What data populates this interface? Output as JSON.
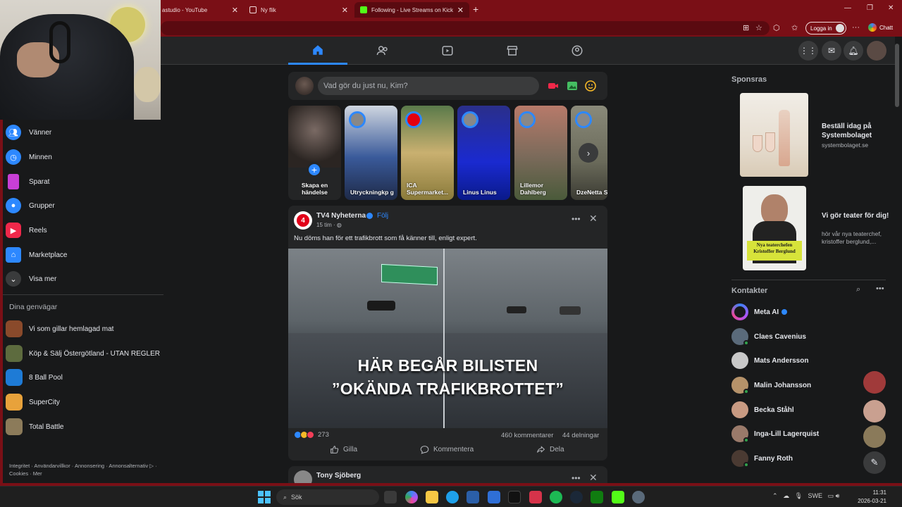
{
  "browser": {
    "tabs": [
      {
        "label": "astudio - YouTube",
        "color": "#ff0000"
      },
      {
        "label": "Ny flik",
        "color": "#8a8a8a"
      },
      {
        "label": "Following - Live Streams on Kick",
        "color": "#53fc18"
      }
    ],
    "login_label": "Logga in",
    "chat_label": "Chatt"
  },
  "fbnav": {
    "tabs": [
      "home-icon",
      "friends-icon",
      "video-icon",
      "marketplace-icon",
      "gaming-icon"
    ],
    "right": [
      "menu-grid-icon",
      "messenger-icon",
      "notifications-icon",
      "profile-avatar"
    ]
  },
  "sidebar": {
    "items": [
      {
        "label": "Vänner",
        "color": "#2d88ff"
      },
      {
        "label": "Minnen",
        "color": "#2d88ff"
      },
      {
        "label": "Sparat",
        "color": "#c83fd6"
      },
      {
        "label": "Grupper",
        "color": "#2d88ff"
      },
      {
        "label": "Reels",
        "color": "#f0284a"
      },
      {
        "label": "Marketplace",
        "color": "#2d88ff"
      },
      {
        "label": "Visa mer",
        "color": "#3a3b3c"
      }
    ],
    "shortcuts_heading": "Dina genvägar",
    "shortcuts": [
      {
        "label": "Vi som gillar hemlagad mat",
        "color": "#8a4a2b"
      },
      {
        "label": "Köp & Sälj Östergötland - UTAN REGLER",
        "color": "#5d6b3e"
      },
      {
        "label": "8 Ball Pool",
        "color": "#1e7bd6"
      },
      {
        "label": "SuperCity",
        "color": "#e8a23b"
      },
      {
        "label": "Total Battle",
        "color": "#8c7b5a"
      }
    ],
    "footer": "Integritet · Användarvillkor · Annonsering · Annonsalternativ ▷ · Cookies · Mer"
  },
  "composer": {
    "placeholder": "Vad gör du just nu, Kim?"
  },
  "stories": {
    "create_label": "Skapa en händelse",
    "items": [
      {
        "label": "Utryckningkp g",
        "color": "#3a5a9a"
      },
      {
        "label": "ICA Supermarket...",
        "color": "#8a7a3a"
      },
      {
        "label": "Linus Linus",
        "color": "#1a2ad0"
      },
      {
        "label": "Lillemor Dahlberg",
        "color": "#7a6a5a"
      },
      {
        "label": "DzeNetta S",
        "color": "#6a6a5a"
      }
    ]
  },
  "post": {
    "author": "TV4 Nyheterna",
    "follow": "Följ",
    "time": "15 tim · ",
    "text": "Nu döms han för ett trafikbrott som få känner till, enligt expert.",
    "headline_1": "HÄR BEGÅR BILISTEN",
    "headline_2": "”OKÄNDA TRAFIKBROTTET”",
    "reactions": "273",
    "comments": "460 kommentarer",
    "shares": "44 delningar",
    "like": "Gilla",
    "comment": "Kommentera",
    "share": "Dela"
  },
  "post2": {
    "author": "Tony Sjöberg"
  },
  "right": {
    "sponsored": "Sponsras",
    "ads": [
      {
        "title": "Beställ idag på Systembolaget",
        "sub": "systembolaget.se"
      },
      {
        "title": "Vi gör teater för dig!",
        "sub": "hör vår nya teaterchef, kristoffer berglund,..."
      }
    ],
    "ad2_poster": "Nya teaterchefen Kristoffer Berglund",
    "contacts_heading": "Kontakter",
    "contacts": [
      {
        "name": "Meta AI",
        "color": "#8a5cf6"
      },
      {
        "name": "Claes Cavenius",
        "color": "#5a6a7a"
      },
      {
        "name": "Mats Andersson",
        "color": "#c8c8c8"
      },
      {
        "name": "Malin Johansson",
        "color": "#b5926a"
      },
      {
        "name": "Becka Ståhl",
        "color": "#c89a82"
      },
      {
        "name": "Inga-Lill Lagerquist",
        "color": "#9a7a6a"
      },
      {
        "name": "Fanny Roth",
        "color": "#4a3a32"
      }
    ]
  },
  "taskbar": {
    "search": "Sök",
    "lang": "SWE",
    "time": "11:31",
    "date": "2026-03-21"
  }
}
